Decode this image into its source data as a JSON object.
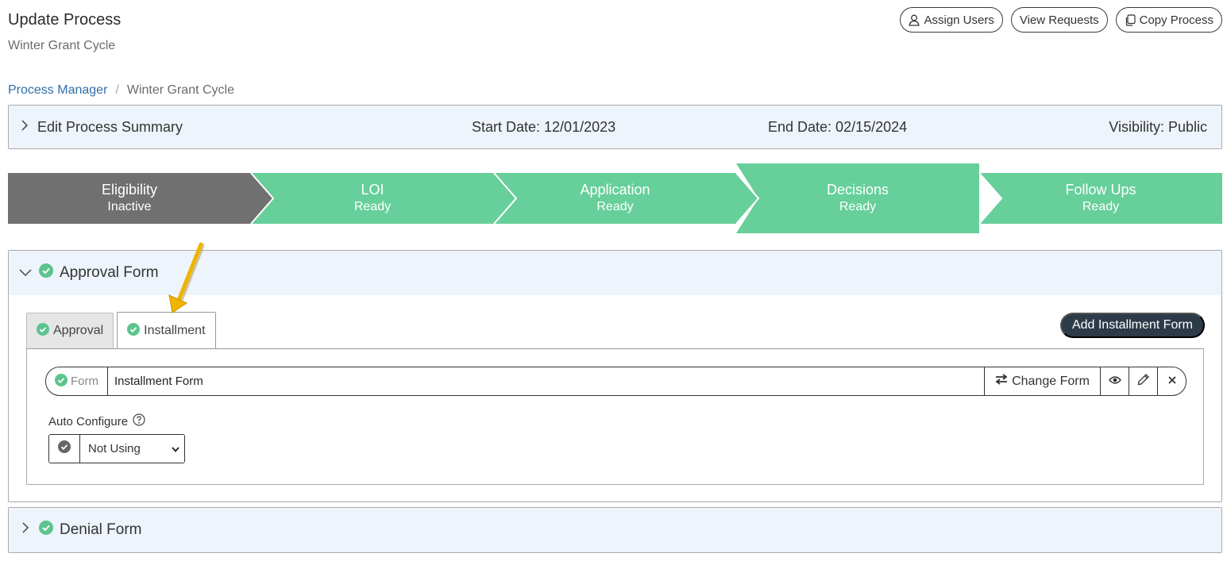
{
  "header": {
    "title": "Update Process",
    "subtitle": "Winter Grant Cycle"
  },
  "actions": {
    "assign_users": "Assign Users",
    "view_requests": "View Requests",
    "copy_process": "Copy Process"
  },
  "breadcrumb": {
    "parent": "Process Manager",
    "separator": "/",
    "current": "Winter Grant Cycle"
  },
  "summary": {
    "toggle_label": "Edit Process Summary",
    "start_date": "Start Date: 12/01/2023",
    "end_date": "End Date: 02/15/2024",
    "visibility": "Visibility: Public"
  },
  "stages": [
    {
      "name": "Eligibility",
      "status": "Inactive",
      "color": "#707070"
    },
    {
      "name": "LOI",
      "status": "Ready",
      "color": "#66cf9a"
    },
    {
      "name": "Application",
      "status": "Ready",
      "color": "#66cf9a"
    },
    {
      "name": "Decisions",
      "status": "Ready",
      "color": "#66cf9a",
      "selected": true
    },
    {
      "name": "Follow Ups",
      "status": "Ready",
      "color": "#66cf9a"
    }
  ],
  "approval_section": {
    "title": "Approval Form",
    "tabs": [
      {
        "label": "Approval",
        "active": false
      },
      {
        "label": "Installment",
        "active": true
      }
    ],
    "add_button": "Add Installment Form",
    "form": {
      "addon_label": "Form",
      "value": "Installment Form",
      "change_label": "Change Form"
    },
    "auto_configure": {
      "label": "Auto Configure",
      "selected": "Not Using"
    }
  },
  "denial_section": {
    "title": "Denial Form"
  },
  "colors": {
    "success": "#5cc48e",
    "link": "#2f6fa7",
    "dark_button": "#2d3a48",
    "annotation_arrow": "#f0b400"
  },
  "icons": [
    "user-icon",
    "copy-icon",
    "chevron-right-icon",
    "chevron-down-icon",
    "check-circle-icon",
    "swap-icon",
    "eye-icon",
    "pencil-icon",
    "close-icon",
    "help-icon",
    "caret-down-icon"
  ]
}
